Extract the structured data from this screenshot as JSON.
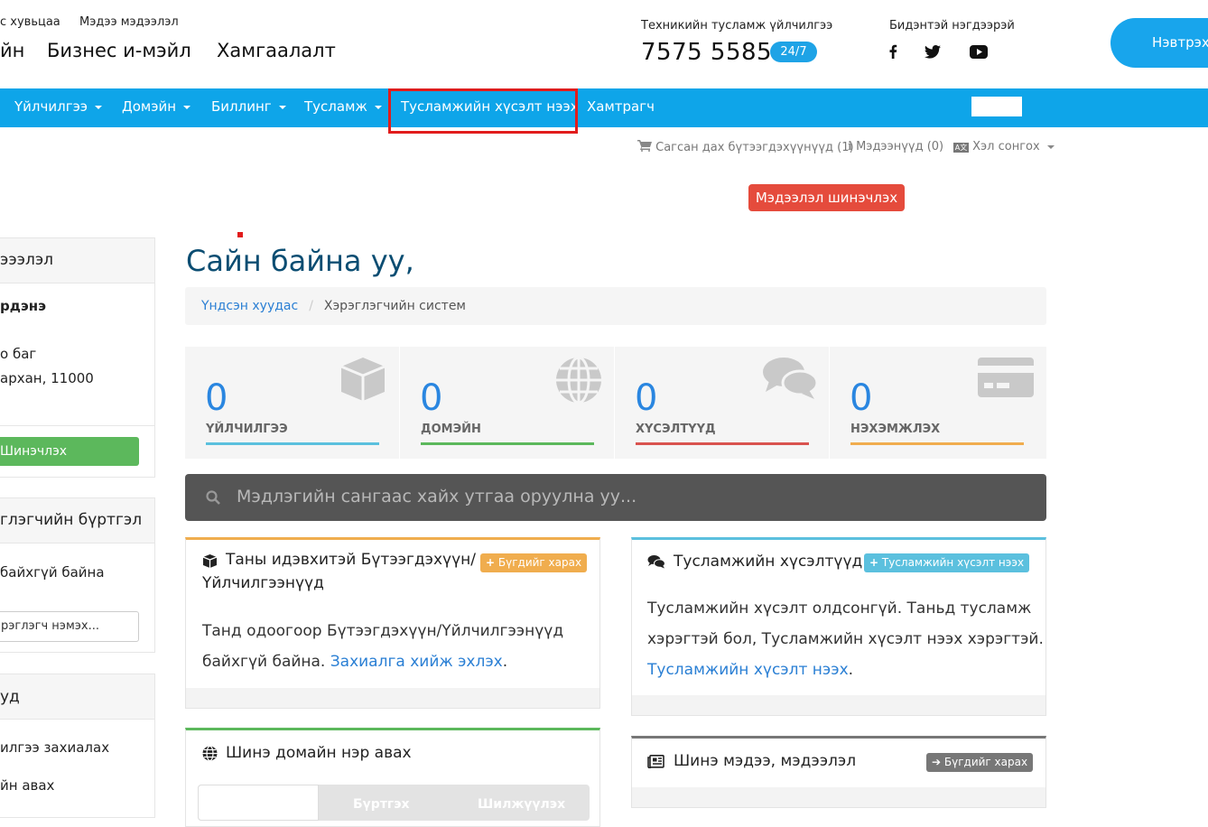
{
  "header": {
    "top_links": [
      "с хувьцаа",
      "Мэдээ мэдээлэл"
    ],
    "main_links": [
      "йн",
      "Бизнес и-мэйл",
      "Хамгаалалт"
    ],
    "support_label": "Техникийн тусламж үйлчилгээ",
    "phone": "7575 5585",
    "support_badge": "24/7",
    "social_label": "Бидэнтэй нэгдээрэй",
    "social_icons": [
      "facebook-icon",
      "twitter-icon",
      "youtube-icon"
    ],
    "login_label": "Нэвтрэх"
  },
  "nav": {
    "items": [
      "Үйлчилгээ",
      "Домэйн",
      "Биллинг",
      "Тусламж",
      "Тусламжийн хүсэлт нээх",
      "Хамтрагч"
    ],
    "update_button": "Мэдээлэл шинэчлэх",
    "greeting": "Сайн уу,"
  },
  "utility": {
    "cart": "Сагсан дах бүтээгдэхүүнүүд (1)",
    "notifications": "Мэдээнүүд (0)",
    "language": "Хэл сонгох"
  },
  "sidebar": {
    "panel1_title": "эээлэл",
    "panel1_name": "рдэнэ",
    "panel1_line1": "о баг",
    "panel1_line2": "архан, 11000",
    "panel1_button": "Шинэчлэх",
    "panel2_title": "глэгчийн бүртгэл",
    "panel2_text": "байхгүй байна",
    "panel2_input": "рэглэгч нэмэх...",
    "panel3_title": "уд",
    "panel3_item1": "илгээ захиалах",
    "panel3_item2": "йн авах"
  },
  "main": {
    "welcome": "Сайн байна уу,",
    "breadcrumb_home": "Үндсэн хуудас",
    "breadcrumb_current": "Хэрэглэгчийн систем",
    "stats": [
      {
        "value": "0",
        "label": "ҮЙЛЧИЛГЭЭ",
        "color": "#5bc0de"
      },
      {
        "value": "0",
        "label": "ДОМЭЙН",
        "color": "#5cb85c"
      },
      {
        "value": "0",
        "label": "ХҮСЭЛТҮҮД",
        "color": "#d9534f"
      },
      {
        "value": "0",
        "label": "НЭХЭМЖЛЭХ",
        "color": "#f0ad4e"
      }
    ],
    "search_placeholder": "Мэдлэгийн сангаас хайх утгаа оруулна уу...",
    "products_card": {
      "title_line1": "Таны идэвхитэй Бүтээгдэхүүн/",
      "title_line2": "Үйлчилгээнүүд",
      "button": "Бүгдийг харах",
      "body_line1": "Танд одоогоор Бүтээгдэхүүн/Үйлчилгээнүүд",
      "body_line2": "байхгүй байна.",
      "body_link": "Захиалга хийж эхлэх",
      "color": "#f0ad4e"
    },
    "tickets_card": {
      "title": "Тусламжийн хүсэлтүүд",
      "button": "Тусламжийн хүсэлт нээх",
      "body_line1": "Тусламжийн хүсэлт олдсонгүй. Таньд тусламж",
      "body_line2": "хэрэгтэй бол, Тусламжийн хүсэлт нээх хэрэгтэй.",
      "body_link": "Тусламжийн хүсэлт нээх",
      "color": "#5bc0de"
    },
    "domain_card": {
      "title": "Шинэ домайн нэр авах",
      "tab2": "Бүртгэх",
      "tab3": "Шилжүүлэх",
      "color": "#5cb85c"
    },
    "news_card": {
      "title": "Шинэ мэдээ, мэдээлэл",
      "button": "Бүгдийг харах",
      "color": "#777777"
    }
  }
}
